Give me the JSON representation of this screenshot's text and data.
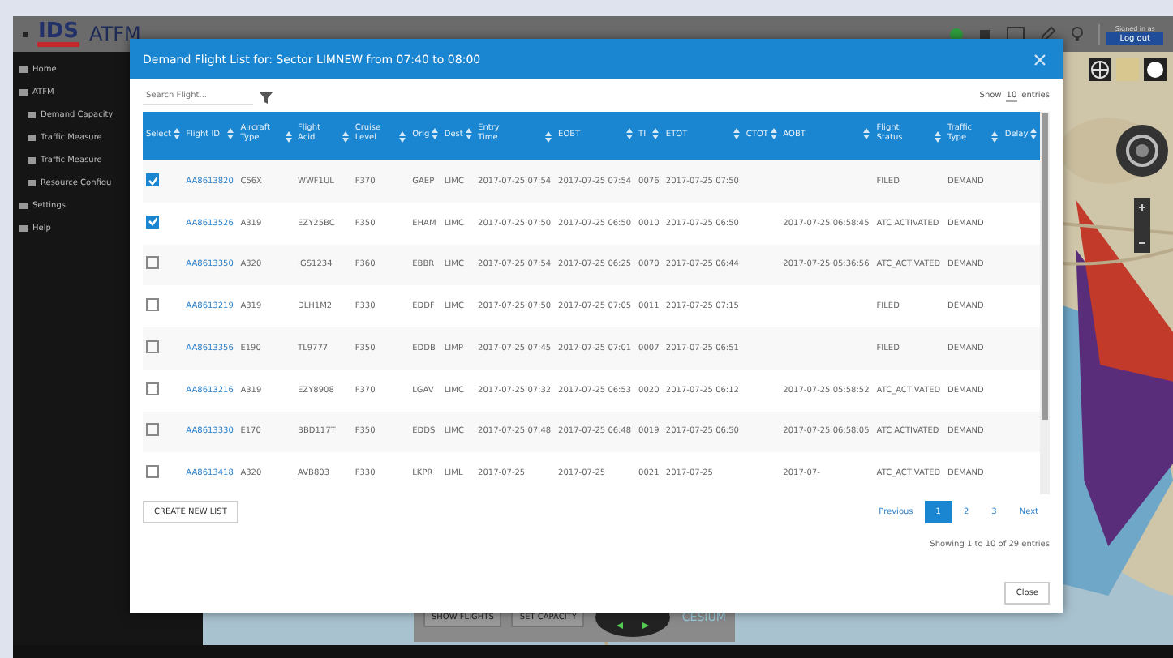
{
  "topbar": {
    "logo": "IDS",
    "title": "ATFM",
    "user_caption": "Signed in as",
    "user_button": "Log out"
  },
  "sidebar": {
    "items": [
      {
        "label": "Home"
      },
      {
        "label": "ATFM",
        "children": [
          {
            "label": "Demand Capacity"
          },
          {
            "label": "Traffic Measure"
          },
          {
            "label": "Traffic Measure"
          },
          {
            "label": "Resource Configu"
          }
        ]
      },
      {
        "label": "Settings"
      },
      {
        "label": "Help"
      }
    ]
  },
  "map": {
    "kind": "picture",
    "toolbar": [
      "SHOW FLIGHTS",
      "SET CAPACITY"
    ],
    "credit": "CESIUM"
  },
  "dialog": {
    "title": "Demand Flight List for: Sector LIMNEW from 07:40 to 08:00",
    "search": {
      "placeholder": "Search Flight..."
    },
    "length_menu": {
      "before": "Show",
      "value": "10",
      "after": "entries"
    },
    "table": {
      "columns": [
        "Select",
        "Flight ID",
        "Aircraft Type",
        "Flight Acid",
        "Cruise Level",
        "Orig",
        "Dest",
        "Entry Time",
        "EOBT",
        "TI",
        "ETOT",
        "CTOT",
        "AOBT",
        "Flight Status",
        "Traffic Type",
        "Delay"
      ],
      "rows": [
        {
          "checked": true,
          "cells": [
            "",
            "AA8613820",
            "C56X",
            "WWF1UL",
            "F370",
            "GAEP",
            "LIMC",
            "2017-07-25 07:54",
            "2017-07-25 07:54",
            "0076",
            "2017-07-25 07:50",
            "",
            "",
            "FILED",
            "DEMAND",
            ""
          ]
        },
        {
          "checked": true,
          "cells": [
            "",
            "AA8613526",
            "A319",
            "EZY25BC",
            "F350",
            "EHAM",
            "LIMC",
            "2017-07-25 07:50",
            "2017-07-25 06:50",
            "0010",
            "2017-07-25 06:50",
            "",
            "2017-07-25 06:58:45",
            "ATC ACTIVATED",
            "DEMAND",
            ""
          ]
        },
        {
          "checked": false,
          "cells": [
            "",
            "AA8613350",
            "A320",
            "IGS1234",
            "F360",
            "EBBR",
            "LIMC",
            "2017-07-25 07:54",
            "2017-07-25 06:25",
            "0070",
            "2017-07-25 06:44",
            "",
            "2017-07-25 05:36:56",
            "ATC_ACTIVATED",
            "DEMAND",
            ""
          ]
        },
        {
          "checked": false,
          "cells": [
            "",
            "AA8613219",
            "A319",
            "DLH1M2",
            "F330",
            "EDDF",
            "LIMC",
            "2017-07-25 07:50",
            "2017-07-25 07:05",
            "0011",
            "2017-07-25 07:15",
            "",
            "",
            "FILED",
            "DEMAND",
            ""
          ]
        },
        {
          "checked": false,
          "cells": [
            "",
            "AA8613356",
            "E190",
            "TL9777",
            "F350",
            "EDDB",
            "LIMP",
            "2017-07-25 07:45",
            "2017-07-25 07:01",
            "0007",
            "2017-07-25 06:51",
            "",
            "",
            "FILED",
            "DEMAND",
            ""
          ]
        },
        {
          "checked": false,
          "cells": [
            "",
            "AA8613216",
            "A319",
            "EZY8908",
            "F370",
            "LGAV",
            "LIMC",
            "2017-07-25 07:32",
            "2017-07-25 06:53",
            "0020",
            "2017-07-25 06:12",
            "",
            "2017-07-25 05:58:52",
            "ATC_ACTIVATED",
            "DEMAND",
            ""
          ]
        },
        {
          "checked": false,
          "cells": [
            "",
            "AA8613330",
            "E170",
            "BBD117T",
            "F350",
            "EDDS",
            "LIMC",
            "2017-07-25 07:48",
            "2017-07-25 06:48",
            "0019",
            "2017-07-25 06:50",
            "",
            "2017-07-25 06:58:05",
            "ATC ACTIVATED",
            "DEMAND",
            ""
          ]
        },
        {
          "checked": false,
          "cells": [
            "",
            "AA8613418",
            "A320",
            "AVB803",
            "F330",
            "LKPR",
            "LIML",
            "2017-07-25",
            "2017-07-25",
            "0021",
            "2017-07-25",
            "",
            "2017-07-",
            "ATC_ACTIVATED",
            "DEMAND",
            ""
          ]
        }
      ]
    },
    "create_button": "CREATE NEW LIST",
    "pagination": [
      {
        "label": "Previous",
        "selected": false
      },
      {
        "label": "1",
        "selected": true
      },
      {
        "label": "2",
        "selected": false
      },
      {
        "label": "3",
        "selected": false
      },
      {
        "label": "Next",
        "selected": false
      }
    ],
    "info": "Showing 1 to 10 of 29 entries",
    "close_button": "Close"
  }
}
